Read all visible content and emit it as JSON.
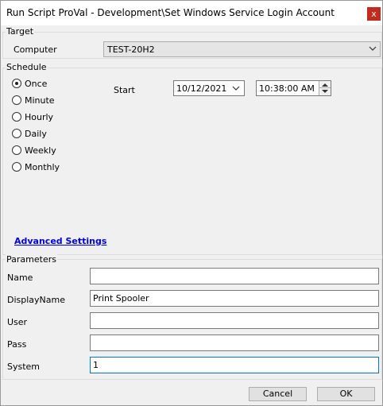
{
  "window": {
    "title": "Run Script ProVal - Development\\Set Windows Service Login Account",
    "close_glyph": "x"
  },
  "target": {
    "group_label": "Target",
    "computer_label": "Computer",
    "computer_value": "TEST-20H2"
  },
  "schedule": {
    "group_label": "Schedule",
    "options": [
      "Once",
      "Minute",
      "Hourly",
      "Daily",
      "Weekly",
      "Monthly"
    ],
    "selected": "Once",
    "start_label": "Start",
    "start_date": "10/12/2021",
    "start_time": "10:38:00 AM",
    "advanced_link": "Advanced Settings"
  },
  "parameters": {
    "group_label": "Parameters",
    "fields": [
      {
        "label": "Name",
        "value": ""
      },
      {
        "label": "DisplayName",
        "value": "Print Spooler"
      },
      {
        "label": "User",
        "value": ""
      },
      {
        "label": "Pass",
        "value": ""
      },
      {
        "label": "System",
        "value": "1"
      }
    ]
  },
  "buttons": {
    "cancel": "Cancel",
    "ok": "OK"
  },
  "colors": {
    "close_bg": "#c42b1c",
    "link": "#0000ee",
    "focus_border": "#0078d7"
  }
}
